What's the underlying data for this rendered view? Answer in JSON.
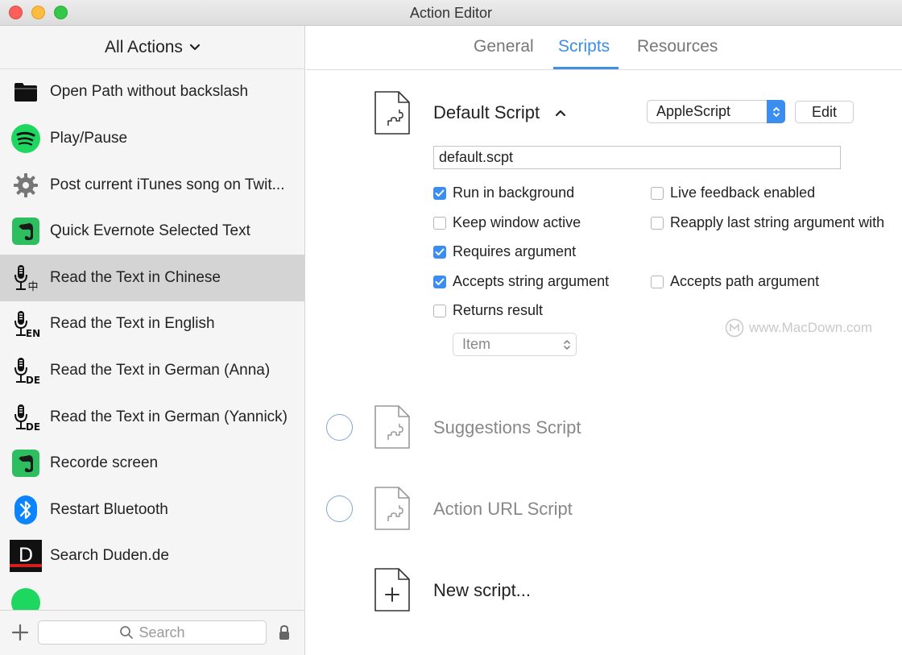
{
  "window": {
    "title": "Action Editor"
  },
  "sidebar": {
    "header_label": "All Actions",
    "items": [
      {
        "label": "Open Path without backslash",
        "icon": "folder-icon"
      },
      {
        "label": "Play/Pause",
        "icon": "spotify-icon"
      },
      {
        "label": "Post current iTunes song on Twit...",
        "icon": "gear-icon"
      },
      {
        "label": "Quick Evernote Selected Text",
        "icon": "evernote-icon"
      },
      {
        "label": "Read the Text in Chinese",
        "icon": "microphone-chinese-icon",
        "selected": true,
        "badge": "中"
      },
      {
        "label": "Read the Text in English",
        "icon": "microphone-english-icon",
        "badge": "EN"
      },
      {
        "label": "Read the Text in German (Anna)",
        "icon": "microphone-german-icon",
        "badge": "DE"
      },
      {
        "label": "Read the Text in German (Yannick)",
        "icon": "microphone-german-icon",
        "badge": "DE"
      },
      {
        "label": "Recorde screen",
        "icon": "evernote-icon"
      },
      {
        "label": "Restart Bluetooth",
        "icon": "bluetooth-icon"
      },
      {
        "label": "Search Duden.de",
        "icon": "duden-icon",
        "badge": "D"
      }
    ],
    "search_placeholder": "Search"
  },
  "tabs": [
    {
      "label": "General",
      "active": false
    },
    {
      "label": "Scripts",
      "active": true
    },
    {
      "label": "Resources",
      "active": false
    }
  ],
  "default_script": {
    "title": "Default Script",
    "language": "AppleScript",
    "edit_label": "Edit",
    "path": "default.scpt",
    "options": [
      {
        "label": "Run in background",
        "checked": true
      },
      {
        "label": "Live feedback enabled",
        "checked": false
      },
      {
        "label": "Keep window active",
        "checked": false
      },
      {
        "label": "Reapply last string argument with",
        "checked": false
      },
      {
        "label": "Requires argument",
        "checked": true
      },
      {
        "label": "Accepts string argument",
        "checked": true
      },
      {
        "label": "Accepts path argument",
        "checked": false
      },
      {
        "label": "Returns result",
        "checked": false
      }
    ],
    "result_type": "Item"
  },
  "other_scripts": [
    {
      "title": "Suggestions Script"
    },
    {
      "title": "Action URL Script"
    }
  ],
  "new_script_label": "New script...",
  "watermark": "www.MacDown.com",
  "colors": {
    "accent": "#3d8fe3",
    "checkbox": "#3b8ef0",
    "selection": "#d4d4d4",
    "spotify": "#1ed760",
    "evernote": "#2dbe60",
    "bluetooth": "#0a84ff"
  }
}
